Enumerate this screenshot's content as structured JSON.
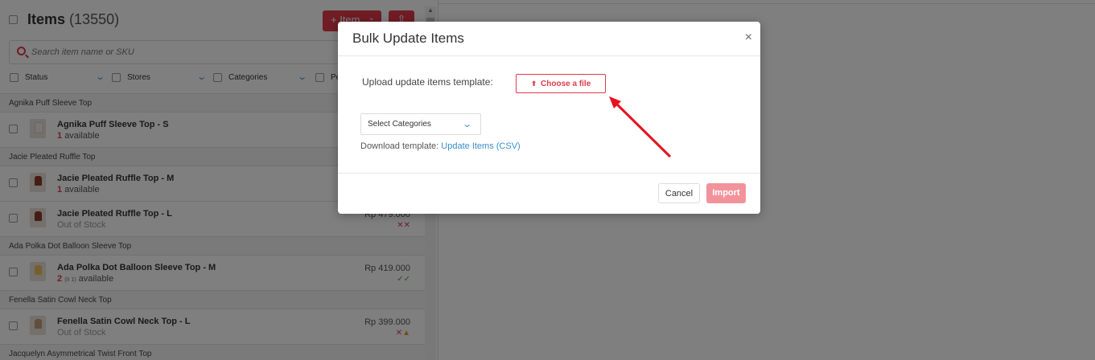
{
  "header": {
    "title": "Items",
    "count": "(13550)",
    "add_item_label": "+ Item",
    "add_item_chevron": "⌄",
    "export_label": "⇧"
  },
  "search": {
    "placeholder": "Search item name or SKU"
  },
  "filters": [
    {
      "label": "Status"
    },
    {
      "label": "Stores"
    },
    {
      "label": "Categories"
    },
    {
      "label": "Pe"
    }
  ],
  "groups": [
    {
      "name": "Agnika Puff Sleeve Top",
      "items": [
        {
          "name": "Agnika Puff Sleeve Top - S",
          "qty": "1",
          "stock_suffix": "available",
          "price": "",
          "mark": ""
        }
      ]
    },
    {
      "name": "Jacie Pleated Ruffle Top",
      "items": [
        {
          "name": "Jacie Pleated Ruffle Top - M",
          "qty": "1",
          "stock_suffix": "available",
          "price": "",
          "mark": ""
        },
        {
          "name": "Jacie Pleated Ruffle Top - L",
          "stock_text": "Out of Stock",
          "price": "Rp 479.000",
          "mark": "✕✕"
        }
      ]
    },
    {
      "name": "Ada Polka Dot Balloon Sleeve Top",
      "items": [
        {
          "name": "Ada Polka Dot Balloon Sleeve Top - M",
          "qty": "2",
          "qty_sub": "(II 1)",
          "stock_suffix": "available",
          "price": "Rp 419.000",
          "mark": "✓✓"
        }
      ]
    },
    {
      "name": "Fenella Satin Cowl Neck Top",
      "items": [
        {
          "name": "Fenella Satin Cowl Neck Top - L",
          "stock_text": "Out of Stock",
          "price": "Rp 399.000",
          "mark": "✕",
          "mark_warn": "▲"
        }
      ]
    },
    {
      "name": "Jacquelyn Asymmetrical Twist Front Top",
      "items": []
    }
  ],
  "modal": {
    "title": "Bulk Update Items",
    "close": "×",
    "upload_label": "Upload update items template:",
    "choose_file_label": "Choose a file",
    "upload_icon": "⬆",
    "select_categories": "Select Categories",
    "select_chevron": "⌄",
    "download_prefix": "Download template:",
    "download_link": "Update Items (CSV)",
    "cancel_label": "Cancel",
    "import_label": "Import"
  },
  "colors": {
    "accent": "#e03a4a",
    "link": "#3a8fc8",
    "import_disabled": "#f2939c"
  }
}
